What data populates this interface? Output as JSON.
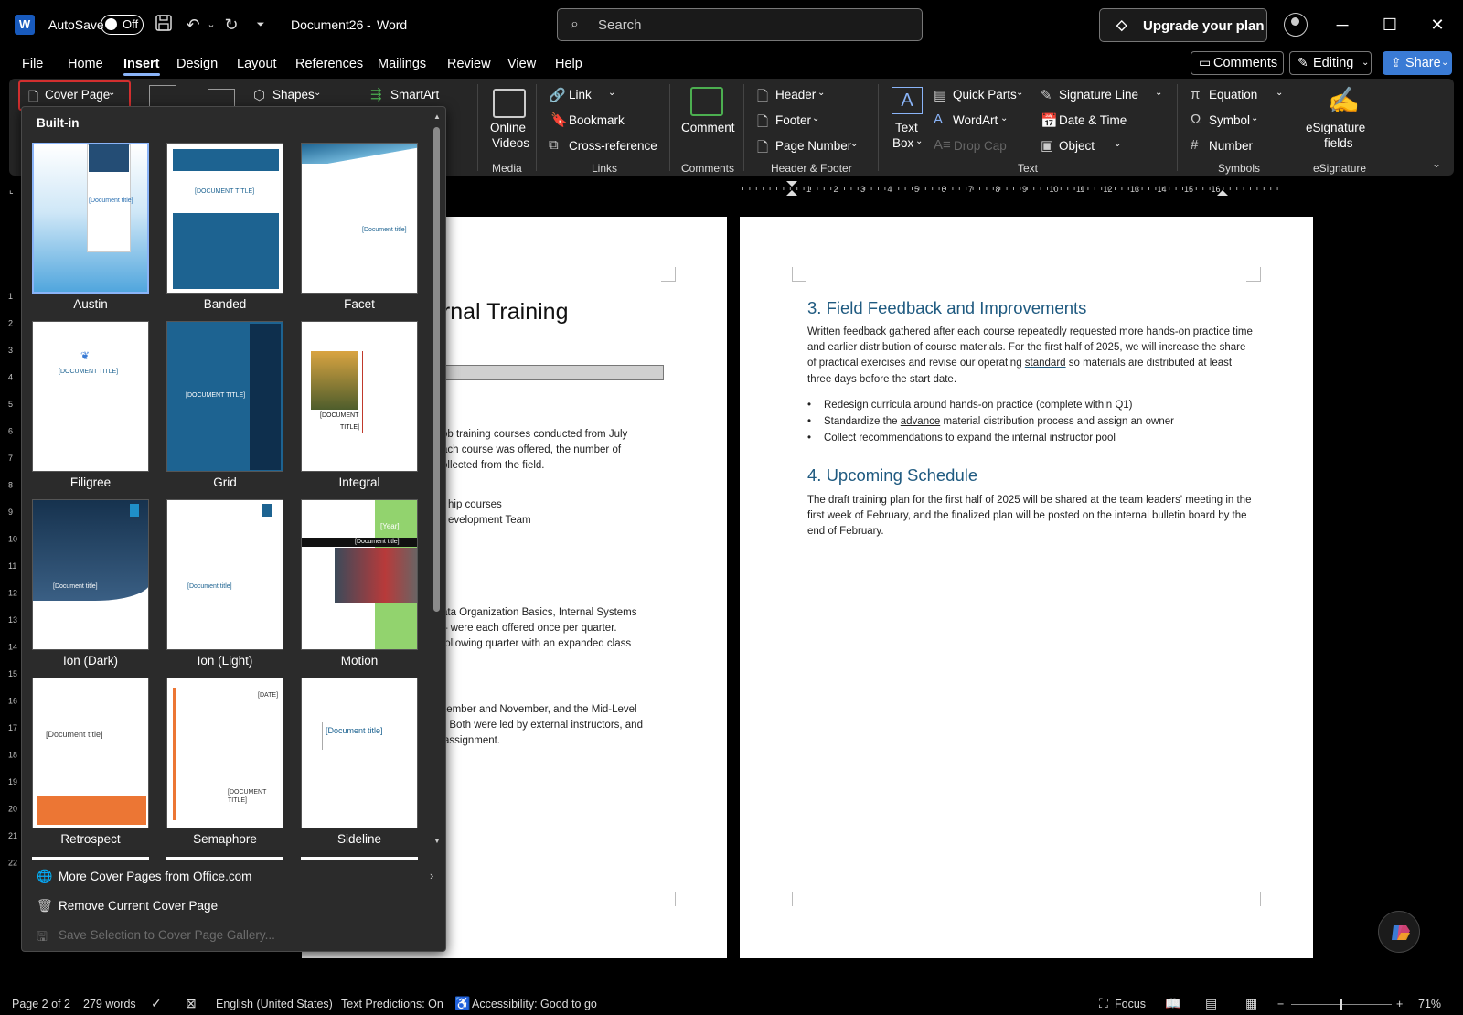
{
  "titlebar": {
    "autosave_label": "AutoSave",
    "autosave_state": "Off",
    "doc_title": "Document26",
    "separator": "-",
    "app_name": "Word",
    "search_placeholder": "Search",
    "upgrade_label": "Upgrade your plan"
  },
  "menu": {
    "tabs": [
      "File",
      "Home",
      "Insert",
      "Design",
      "Layout",
      "References",
      "Mailings",
      "Review",
      "View",
      "Help"
    ],
    "active_tab": "Insert",
    "comments_label": "Comments",
    "editing_label": "Editing",
    "share_label": "Share"
  },
  "ribbon": {
    "cover_page": "Cover Page",
    "shapes": "Shapes",
    "smartart": "SmartArt",
    "online_videos_1": "Online",
    "online_videos_2": "Videos",
    "link": "Link",
    "bookmark": "Bookmark",
    "cross_reference": "Cross-reference",
    "comment": "Comment",
    "header": "Header",
    "footer": "Footer",
    "page_number": "Page Number",
    "text_box_1": "Text",
    "text_box_2": "Box",
    "quick_parts": "Quick Parts",
    "wordart": "WordArt",
    "drop_cap": "Drop Cap",
    "signature_line": "Signature Line",
    "date_time": "Date & Time",
    "object": "Object",
    "equation": "Equation",
    "symbol": "Symbol",
    "number": "Number",
    "esignature_1": "eSignature",
    "esignature_2": "fields",
    "groups": {
      "media": "Media",
      "links": "Links",
      "comments": "Comments",
      "header_footer": "Header & Footer",
      "text": "Text",
      "symbols": "Symbols",
      "esignature": "eSignature"
    }
  },
  "cover_gallery": {
    "heading": "Built-in",
    "items": [
      "Austin",
      "Banded",
      "Facet",
      "Filigree",
      "Grid",
      "Integral",
      "Ion (Dark)",
      "Ion (Light)",
      "Motion",
      "Retrospect",
      "Semaphore",
      "Sideline"
    ],
    "thumb_text": {
      "doc_title_upper": "[DOCUMENT TITLE]",
      "doc_title": "[Document title]",
      "doc_title_short": "[Document",
      "doc_title_end": "title]",
      "doc_title_upper_1": "[DOCUMENT",
      "doc_title_upper_2": "TITLE]",
      "year": "[Year]",
      "date": "[DATE]"
    },
    "more": "More Cover Pages from Office.com",
    "remove": "Remove Current Cover Page",
    "save": "Save Selection to Cover Page Gallery..."
  },
  "page1": {
    "heading_fragment": "ernal Training",
    "para1": [
      "ob training courses conducted from July",
      "ach course was offered, the number of",
      "ollected from the field."
    ],
    "para2": [
      "hip courses",
      "evelopment Team"
    ],
    "para3": [
      "ata Organization Basics, Internal Systems",
      "– were each offered once per quarter.",
      "following quarter with an expanded class"
    ],
    "para4": [
      "tember and November, and the Mid-Level",
      ". Both were led by external instructors, and",
      " assignment."
    ]
  },
  "page2": {
    "h3": "3. Field Feedback and Improvements",
    "p1_a": "Written feedback gathered after each course repeatedly requested more hands-on practice time and earlier distribution of course materials. For the first half of 2025, we will increase the share of practical exercises and revise our operating ",
    "p1_link": "standard",
    "p1_b": " so materials are distributed at least three days before the start date.",
    "bullet1": "Redesign curricula around hands-on practice (complete within Q1)",
    "bullet2_a": "Standardize the ",
    "bullet2_link": "advance",
    "bullet2_b": " material distribution process and assign an owner",
    "bullet3": "Collect recommendations to expand the internal instructor pool",
    "h4": "4. Upcoming Schedule",
    "p2": "The draft training plan for the first half of 2025 will be shared at the team leaders' meeting in the first week of February, and the finalized plan will be posted on the internal bulletin board by the end of February."
  },
  "ruler_numbers": [
    "1",
    "2",
    "3",
    "4",
    "5",
    "6",
    "7",
    "8",
    "9",
    "10",
    "11",
    "12",
    "13",
    "14",
    "15",
    "16"
  ],
  "vruler_numbers": [
    "1",
    "2",
    "3",
    "4",
    "5",
    "6",
    "7",
    "8",
    "9",
    "10",
    "11",
    "12",
    "13",
    "14",
    "15",
    "16",
    "17",
    "18",
    "19",
    "20",
    "21",
    "22"
  ],
  "status": {
    "page": "Page 2 of 2",
    "words": "279 words",
    "language": "English (United States)",
    "predictions": "Text Predictions: On",
    "accessibility": "Accessibility: Good to go",
    "focus": "Focus",
    "zoom": "71%"
  },
  "colors": {
    "accent": "#8ab4f8",
    "heading_blue": "#1f5a80",
    "share_blue": "#3a7bd5",
    "highlight_red": "#d32f2f"
  }
}
